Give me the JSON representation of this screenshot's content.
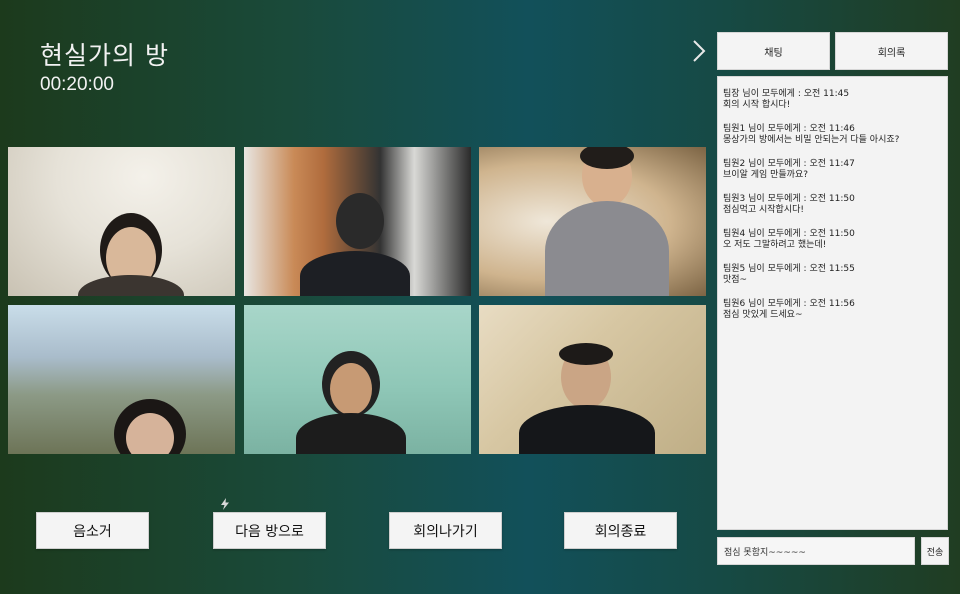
{
  "room": {
    "title": "현실가의 방",
    "timer": "00:20:00"
  },
  "panel_toggle_icon": "chevron-right-icon",
  "controls": {
    "mute_label": "음소거",
    "next_room_label": "다음 방으로",
    "leave_label": "회의나가기",
    "end_label": "회의종료"
  },
  "tabs": {
    "chat_label": "채팅",
    "minutes_label": "회의록"
  },
  "chat": {
    "messages": [
      {
        "header": "팀장 님이 모두에게 : 오전 11:45",
        "text": "회의 시작 합시다!"
      },
      {
        "header": "팀원1 님이 모두에게 : 오전 11:46",
        "text": "몽상가의 방에서는 비밀 안되는거 다들 아시죠?"
      },
      {
        "header": "팀원2 님이 모두에게 : 오전 11:47",
        "text": "브이알 게임 만들까요?"
      },
      {
        "header": "팀원3 님이 모두에게 : 오전 11:50",
        "text": "점심먹고 시작합시다!"
      },
      {
        "header": "팀원4 님이 모두에게 : 오전 11:50",
        "text": "오 저도 그말하려고 했는데!"
      },
      {
        "header": "팀원5 님이 모두에게 : 오전 11:55",
        "text": "맛점~"
      },
      {
        "header": "팀원6 님이 모두에게 : 오전 11:56",
        "text": "점심 맛있게 드세요~"
      }
    ],
    "input_value": "점심 못함지~~~~~",
    "send_label": "전송"
  }
}
